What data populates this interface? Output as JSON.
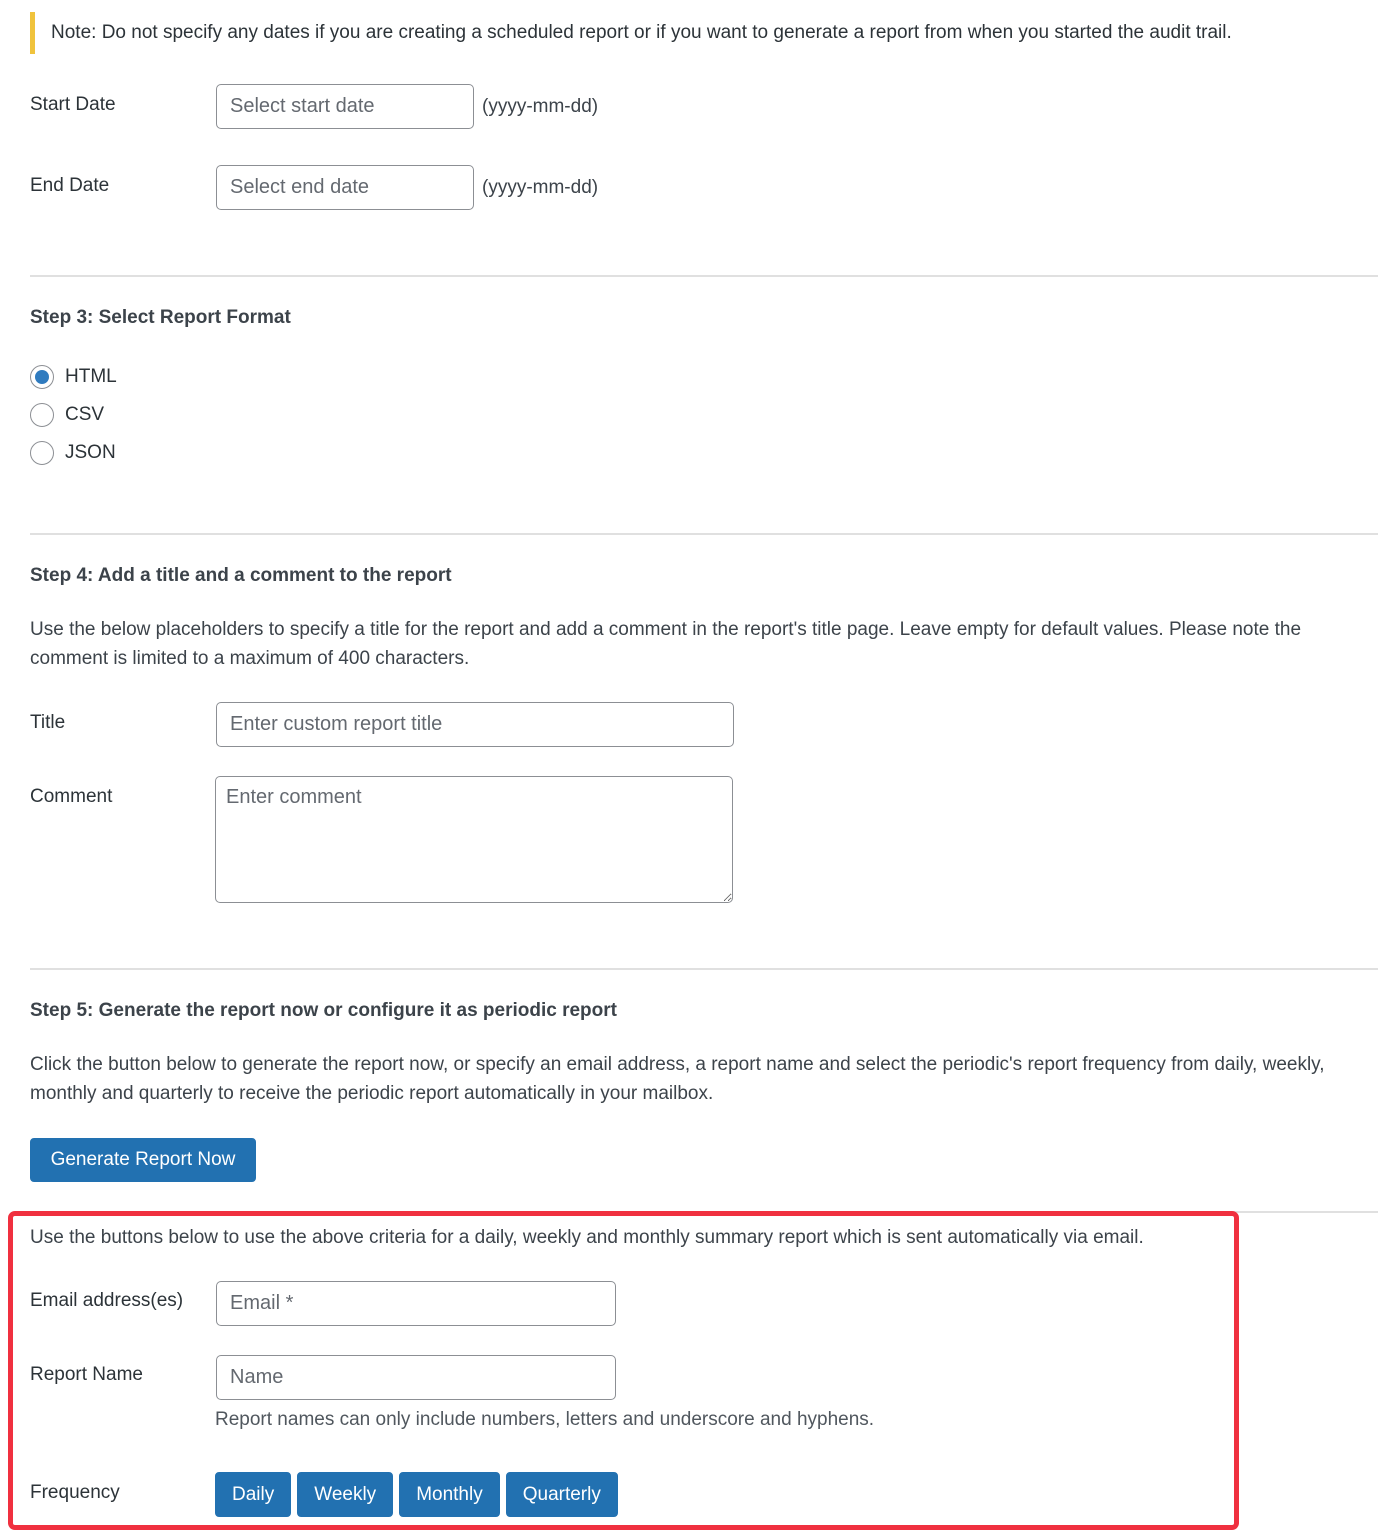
{
  "notice": {
    "text": "Note: Do not specify any dates if you are creating a scheduled report or if you want to generate a report from when you started the audit trail.",
    "accent_color": "#f0c33c"
  },
  "date_range": {
    "start": {
      "label": "Start Date",
      "placeholder": "Select start date",
      "value": "",
      "format_hint": "(yyyy-mm-dd)"
    },
    "end": {
      "label": "End Date",
      "placeholder": "Select end date",
      "value": "",
      "format_hint": "(yyyy-mm-dd)"
    }
  },
  "step3": {
    "heading": "Step 3: Select Report Format",
    "options": [
      {
        "label": "HTML",
        "selected": true
      },
      {
        "label": "CSV",
        "selected": false
      },
      {
        "label": "JSON",
        "selected": false
      }
    ]
  },
  "step4": {
    "heading": "Step 4: Add a title and a comment to the report",
    "description": "Use the below placeholders to specify a title for the report and add a comment in the report's title page. Leave empty for default values. Please note the comment is limited to a maximum of 400 characters.",
    "title": {
      "label": "Title",
      "placeholder": "Enter custom report title",
      "value": ""
    },
    "comment": {
      "label": "Comment",
      "placeholder": "Enter comment",
      "value": ""
    }
  },
  "step5": {
    "heading": "Step 5: Generate the report now or configure it as periodic report",
    "description": "Click the button below to generate the report now, or specify an email address, a report name and select the periodic's report frequency from daily, weekly, monthly and quarterly to receive the periodic report automatically in your mailbox.",
    "generate_button": "Generate Report Now"
  },
  "periodic": {
    "intro": "Use the buttons below to use the above criteria for a daily, weekly and monthly summary report which is sent automatically via email.",
    "email": {
      "label": "Email address(es)",
      "placeholder": "Email *",
      "value": ""
    },
    "report_name": {
      "label": "Report Name",
      "placeholder": "Name",
      "value": "",
      "hint": "Report names can only include numbers, letters and underscore and hyphens."
    },
    "frequency": {
      "label": "Frequency",
      "buttons": [
        "Daily",
        "Weekly",
        "Monthly",
        "Quarterly"
      ]
    },
    "highlight_color": "#f0303f"
  },
  "colors": {
    "primary_button": "#2271b1",
    "radio_selected": "#2f7bbf"
  }
}
